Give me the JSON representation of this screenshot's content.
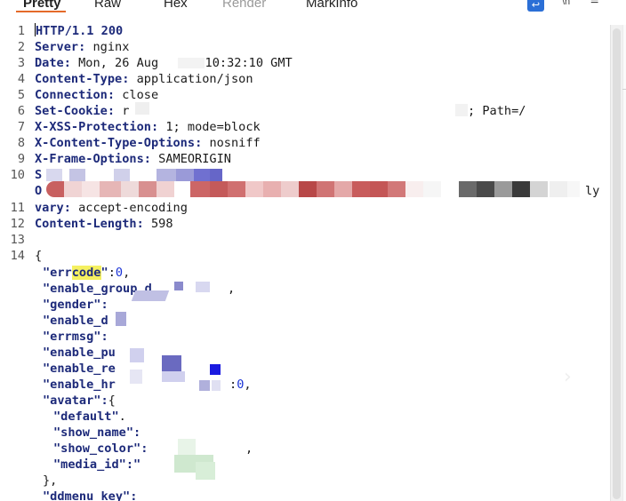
{
  "tabs": [
    {
      "label": "Pretty",
      "active": true
    },
    {
      "label": "Raw",
      "active": false
    },
    {
      "label": "Hex",
      "active": false
    },
    {
      "label": "Render",
      "active": false,
      "muted": true
    },
    {
      "label": "MarkInfo",
      "active": false
    }
  ],
  "toolbar": {
    "wrap_icon": "wrap-lines-icon",
    "wrap_glyph": "↩",
    "whitespace_icon": "show-whitespace-icon",
    "whitespace_glyph": "\\n",
    "menu_icon": "menu-icon",
    "menu_glyph": "≡"
  },
  "accent_color": "#e46a2a",
  "response": {
    "line_numbers": [
      "1",
      "2",
      "3",
      "4",
      "5",
      "6",
      "7",
      "8",
      "9",
      "10",
      "11",
      "12",
      "13",
      "14"
    ],
    "status_line": "HTTP/1.1 200",
    "headers": [
      {
        "key": "Server",
        "value": "nginx"
      },
      {
        "key": "Date",
        "value": "Mon, 26 Aug ",
        "value2": " 10:32:10 GMT"
      },
      {
        "key": "Content-Type",
        "value": "application/json"
      },
      {
        "key": "Connection",
        "value": "close"
      },
      {
        "key": "Set-Cookie",
        "value": "r",
        "tail": "; Path=/"
      },
      {
        "key": "X-XSS-Protection",
        "value": "1; mode=block"
      },
      {
        "key": "X-Content-Type-Options",
        "value": "nosniff"
      },
      {
        "key": "X-Frame-Options",
        "value": "SAMEORIGIN"
      },
      {
        "key": "S",
        "value": ""
      },
      {
        "key": "vary",
        "value": "accept-encoding"
      },
      {
        "key": "Content-Length",
        "value": "598"
      }
    ],
    "line10_second_row_start": "O",
    "line10_second_row_end": "ly",
    "body": {
      "open_brace": "{",
      "errcode_key_a": "\"err",
      "errcode_key_b": "code",
      "errcode_key_c": "\"",
      "errcode_val": "0",
      "enable_group_key": "\"enable_group_d",
      "gender_key": "\"gender\":",
      "enable_d_key": "\"enable_d",
      "errmsg_key": "\"errmsg\":",
      "enable_pu_key": "\"enable_pu",
      "enable_re_key": "\"enable_re",
      "enable_hr_key": "\"enable_hr",
      "enable_hr_val": "0",
      "avatar_key": "\"avatar\":",
      "avatar_brace": "{",
      "default_key": "\"default\"",
      "show_name_key": "\"show_name\":",
      "show_color_key": "\"show_color\":",
      "media_id_key": "\"media_id\":\"",
      "close_obj": "},",
      "ddmenu_key": "\"ddmenu_key\":"
    }
  }
}
